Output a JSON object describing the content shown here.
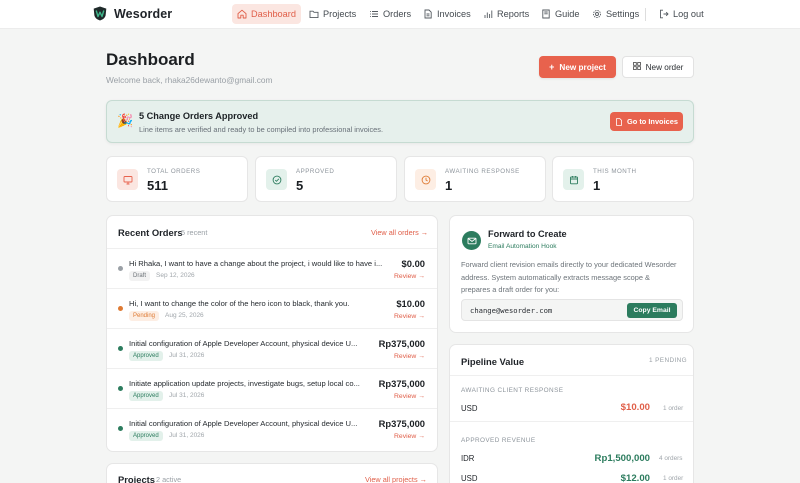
{
  "brand": {
    "name": "Wesorder"
  },
  "nav": {
    "dashboard": "Dashboard",
    "projects": "Projects",
    "orders": "Orders",
    "invoices": "Invoices",
    "reports": "Reports",
    "guide": "Guide",
    "settings": "Settings",
    "logout": "Log out"
  },
  "header": {
    "title": "Dashboard",
    "welcome": "Welcome back, rhaka26dewanto@gmail.com",
    "new_project": "New project",
    "new_order": "New order"
  },
  "banner": {
    "title": "5 Change Orders Approved",
    "subtitle": "Line items are verified and ready to be compiled into professional invoices.",
    "button": "Go to Invoices"
  },
  "stats": [
    {
      "label": "TOTAL ORDERS",
      "value": "511",
      "color": "#e8624d",
      "icon": "monitor-icon"
    },
    {
      "label": "APPROVED",
      "value": "5",
      "color": "#2c7c5e",
      "icon": "check-circle-icon"
    },
    {
      "label": "AWAITING RESPONSE",
      "value": "1",
      "color": "#de7a33",
      "icon": "clock-icon"
    },
    {
      "label": "THIS MONTH",
      "value": "1",
      "color": "#2c7c5e",
      "icon": "calendar-icon"
    }
  ],
  "recent_orders": {
    "title": "Recent Orders",
    "count": "5 recent",
    "view_all": "View all orders →",
    "rows": [
      {
        "text": "Hi Rhaka, I want to have a change about the project, i would like to have i...",
        "status": "Draft",
        "date": "Sep 12, 2026",
        "amount": "$0.00",
        "review": "Review →"
      },
      {
        "text": "Hi, I want to change the color of the hero icon to black, thank you.",
        "status": "Pending",
        "date": "Aug 25, 2026",
        "amount": "$10.00",
        "review": "Review →"
      },
      {
        "text": "Initial configuration of Apple Developer Account, physical device U...",
        "status": "Approved",
        "date": "Jul 31, 2026",
        "amount": "Rp375,000",
        "review": "Review →"
      },
      {
        "text": "Initiate application update projects, investigate bugs, setup local co...",
        "status": "Approved",
        "date": "Jul 31, 2026",
        "amount": "Rp375,000",
        "review": "Review →"
      },
      {
        "text": "Initial configuration of Apple Developer Account, physical device U...",
        "status": "Approved",
        "date": "Jul 31, 2026",
        "amount": "Rp375,000",
        "review": "Review →"
      }
    ]
  },
  "projects": {
    "title": "Projects",
    "count": "2 active",
    "view_all": "View all projects →"
  },
  "forward": {
    "title": "Forward to Create",
    "subtitle": "Email Automation Hook",
    "description": "Forward client revision emails directly to your dedicated Wesorder address. System automatically extracts message scope & prepares a draft order for you:",
    "email": "change@wesorder.com",
    "copy_button": "Copy Email"
  },
  "pipeline": {
    "title": "Pipeline Value",
    "pending": "1 PENDING",
    "awaiting_label": "AWAITING CLIENT RESPONSE",
    "awaiting": [
      {
        "currency": "USD",
        "value": "$10.00",
        "count": "1 order"
      }
    ],
    "approved_label": "APPROVED REVENUE",
    "approved": [
      {
        "currency": "IDR",
        "value": "Rp1,500,000",
        "count": "4 orders"
      },
      {
        "currency": "USD",
        "value": "$12.00",
        "count": "1 order"
      }
    ]
  },
  "colors": {
    "accent": "#e8624d",
    "green": "#2c7c5e",
    "orange": "#de7a33",
    "draft": "#9aa0a6"
  }
}
